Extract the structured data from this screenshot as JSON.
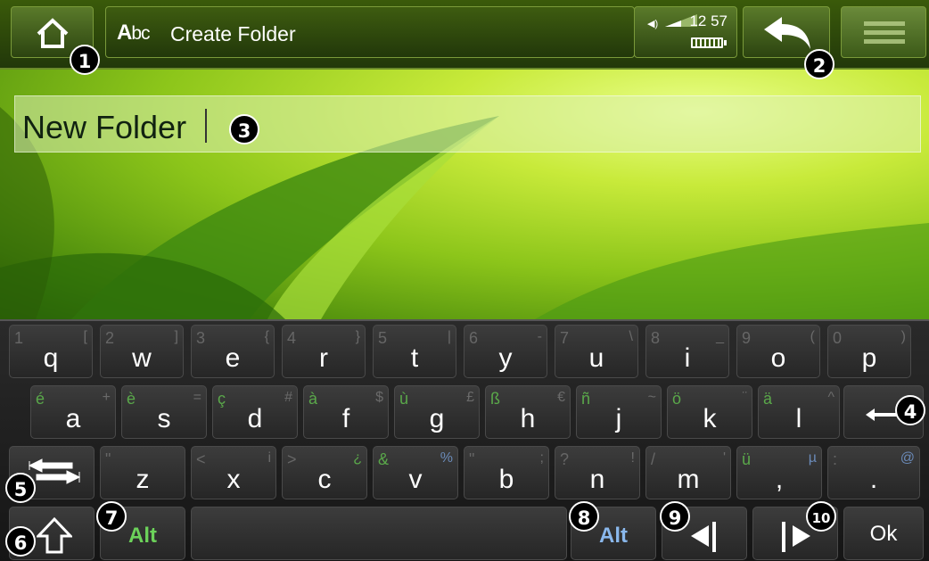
{
  "header": {
    "title": "Create Folder",
    "title_icon": {
      "name": "abc-icon",
      "first": "A",
      "rest": "bc"
    },
    "home_icon": "home-icon",
    "back_icon": "back-arrow-icon",
    "menu_icon": "menu-icon",
    "status": {
      "time": "12 57",
      "volume_icon": "speaker-icon",
      "battery_icon": "battery-icon"
    }
  },
  "text_field": {
    "value": "New Folder"
  },
  "callouts": [
    "1",
    "2",
    "3",
    "4",
    "5",
    "6",
    "7",
    "8",
    "9",
    "10"
  ],
  "keyboard": {
    "row1": [
      {
        "key": "q",
        "alt": "1",
        "alt2": "["
      },
      {
        "key": "w",
        "alt": "2",
        "alt2": "]"
      },
      {
        "key": "e",
        "alt": "3",
        "alt2": "{"
      },
      {
        "key": "r",
        "alt": "4",
        "alt2": "}"
      },
      {
        "key": "t",
        "alt": "5",
        "alt2": "|"
      },
      {
        "key": "y",
        "alt": "6",
        "alt2": "-"
      },
      {
        "key": "u",
        "alt": "7",
        "alt2": "\\"
      },
      {
        "key": "i",
        "alt": "8",
        "alt2": "_"
      },
      {
        "key": "o",
        "alt": "9",
        "alt2": "("
      },
      {
        "key": "p",
        "alt": "0",
        "alt2": ")"
      }
    ],
    "row2": [
      {
        "key": "a",
        "alt": "é",
        "alt2": "+"
      },
      {
        "key": "s",
        "alt": "è",
        "alt2": "="
      },
      {
        "key": "d",
        "alt": "ç",
        "alt2": "#"
      },
      {
        "key": "f",
        "alt": "à",
        "alt2": "$"
      },
      {
        "key": "g",
        "alt": "ù",
        "alt2": "£"
      },
      {
        "key": "h",
        "alt": "ß",
        "alt2": "€"
      },
      {
        "key": "j",
        "alt": "ñ",
        "alt2": "~"
      },
      {
        "key": "k",
        "alt": "ö",
        "alt2": "¨"
      },
      {
        "key": "l",
        "alt": "ä",
        "alt2": "^"
      }
    ],
    "row3": [
      {
        "key": "z",
        "alt": "\"",
        "alt2": ""
      },
      {
        "key": "x",
        "alt": "<",
        "alt2": "i"
      },
      {
        "key": "c",
        "alt": ">",
        "alt2": "¿"
      },
      {
        "key": "v",
        "alt": "&",
        "alt2": "%"
      },
      {
        "key": "b",
        "alt": "\"",
        "alt2": ";"
      },
      {
        "key": "n",
        "alt": "?",
        "alt2": "!"
      },
      {
        "key": "m",
        "alt": "/",
        "alt2": "'"
      },
      {
        "key": ",",
        "alt": "ü",
        "alt2": "µ"
      },
      {
        "key": ".",
        "alt": ":",
        "alt2": "@"
      }
    ],
    "backspace_icon": "backspace-arrow-icon",
    "tab_icon": "tab-arrows-icon",
    "shift_icon": "shift-arrow-icon",
    "alt_left_label": "Alt",
    "alt_right_label": "Alt",
    "cursor_left_icon": "cursor-left-icon",
    "cursor_right_icon": "cursor-right-icon",
    "ok_label": "Ok"
  },
  "colors": {
    "alt_green": "#6cd25a",
    "alt_blue": "#8ab8ec"
  }
}
